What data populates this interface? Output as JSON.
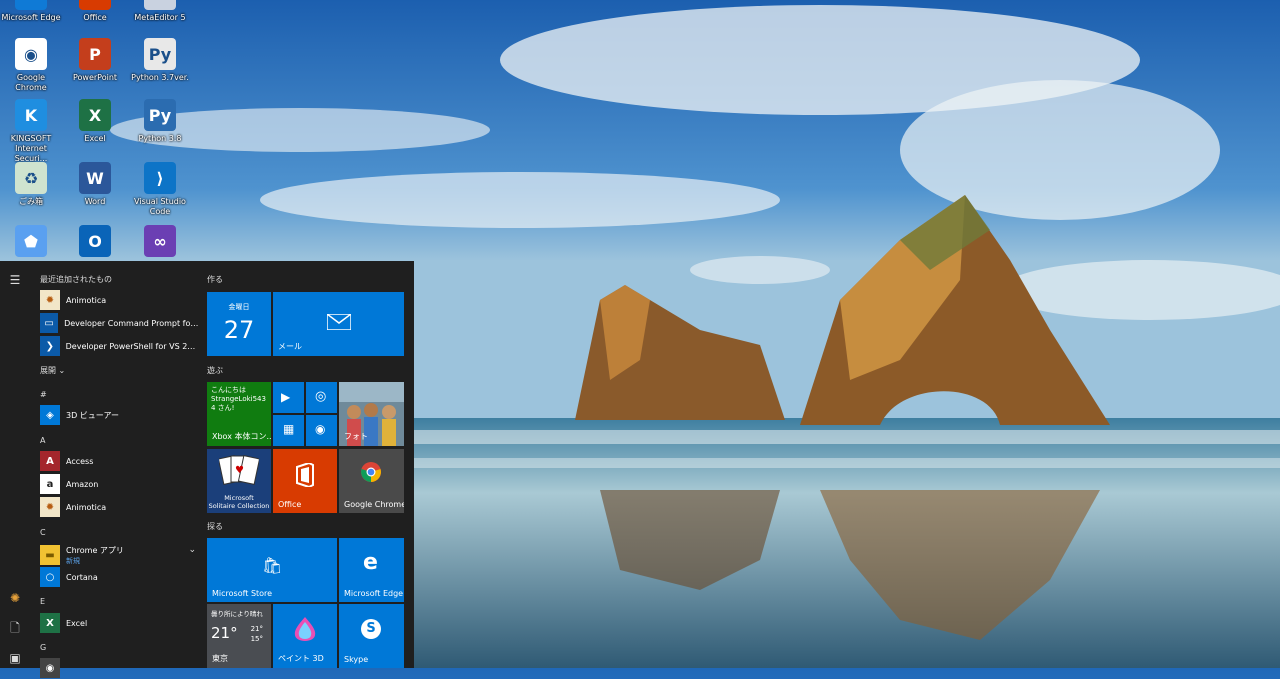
{
  "desktop": {
    "icons": [
      {
        "label": "Microsoft Edge",
        "icon": "edge-icon"
      },
      {
        "label": "Office",
        "icon": "office-icon"
      },
      {
        "label": "MetaEditor 5",
        "icon": "metaeditor-icon"
      },
      {
        "label": "Google Chrome",
        "icon": "chrome-icon"
      },
      {
        "label": "PowerPoint",
        "icon": "powerpoint-icon"
      },
      {
        "label": "Python 3.7ver.",
        "icon": "python-file-icon"
      },
      {
        "label": "KINGSOFT Internet Securi...",
        "icon": "kingsoft-icon"
      },
      {
        "label": "Excel",
        "icon": "excel-icon"
      },
      {
        "label": "Python 3.8",
        "icon": "python-icon"
      },
      {
        "label": "ごみ箱",
        "icon": "recycle-bin-icon"
      },
      {
        "label": "Word",
        "icon": "word-icon"
      },
      {
        "label": "Visual Studio Code",
        "icon": "vscode-icon"
      },
      {
        "label": "",
        "icon": "pentagon-app-icon"
      },
      {
        "label": "",
        "icon": "outlook-icon"
      },
      {
        "label": "",
        "icon": "visual-studio-icon"
      }
    ]
  },
  "start_menu": {
    "recent_header": "最近追加されたもの",
    "recent": [
      {
        "label": "Animotica"
      },
      {
        "label": "Developer Command Prompt for VS..."
      },
      {
        "label": "Developer PowerShell for VS 2019"
      }
    ],
    "expand_label": "展開",
    "sections": [
      {
        "letter": "#",
        "apps": [
          {
            "label": "3D ビューアー"
          }
        ]
      },
      {
        "letter": "A",
        "apps": [
          {
            "label": "Access"
          },
          {
            "label": "Amazon"
          },
          {
            "label": "Animotica"
          }
        ]
      },
      {
        "letter": "C",
        "apps": [
          {
            "label": "Chrome アプリ",
            "sub": "新規"
          },
          {
            "label": "Cortana"
          }
        ]
      },
      {
        "letter": "E",
        "apps": [
          {
            "label": "Excel"
          }
        ]
      },
      {
        "letter": "G",
        "apps": []
      }
    ],
    "groups": {
      "create": "作る",
      "play": "遊ぶ",
      "explore": "探る"
    },
    "tiles": {
      "calendar_day": "金曜日",
      "calendar_date": "27",
      "mail": "メール",
      "xbox_line1": "こんにちは",
      "xbox_line2": "StrangeLoki543",
      "xbox_line3": "4 さん!",
      "xbox_label": "Xbox 本体コン...",
      "photos_label": "フォト",
      "solitaire_line1": "Microsoft",
      "solitaire_line2": "Solitaire Collection",
      "office": "Office",
      "chrome": "Google Chrome",
      "store": "Microsoft Store",
      "edge": "Microsoft Edge",
      "weather_condition": "曇り所により晴れ",
      "weather_temp": "21°",
      "weather_high": "21°",
      "weather_low": "15°",
      "weather_city": "東京",
      "paint3d": "ペイント 3D",
      "skype": "Skype"
    }
  },
  "colors": {
    "accent": "#0078d7",
    "start_bg": "#1f1f1f",
    "xbox": "#107c10",
    "office": "#d83b01"
  }
}
